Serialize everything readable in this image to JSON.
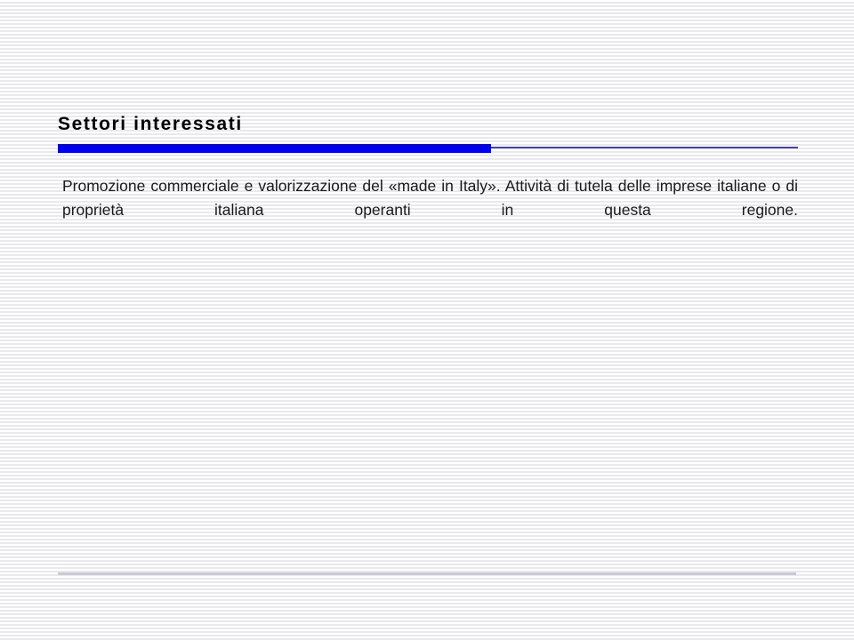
{
  "slide": {
    "title": "Settori interessati",
    "body": "Promozione commerciale e valorizzazione del «made in Italy». Attività di tutela delle imprese italiane o di proprietà italiana operanti in questa regione.",
    "accent_color": "#0000EE",
    "accent_line_color": "#4242A8",
    "footer_rule_color": "#C9C9D4",
    "title_color": "#000000",
    "body_color": "#1A1A1A",
    "background_stripe_color": "#E9E9ED",
    "background_base_color": "#FFFFFF"
  }
}
